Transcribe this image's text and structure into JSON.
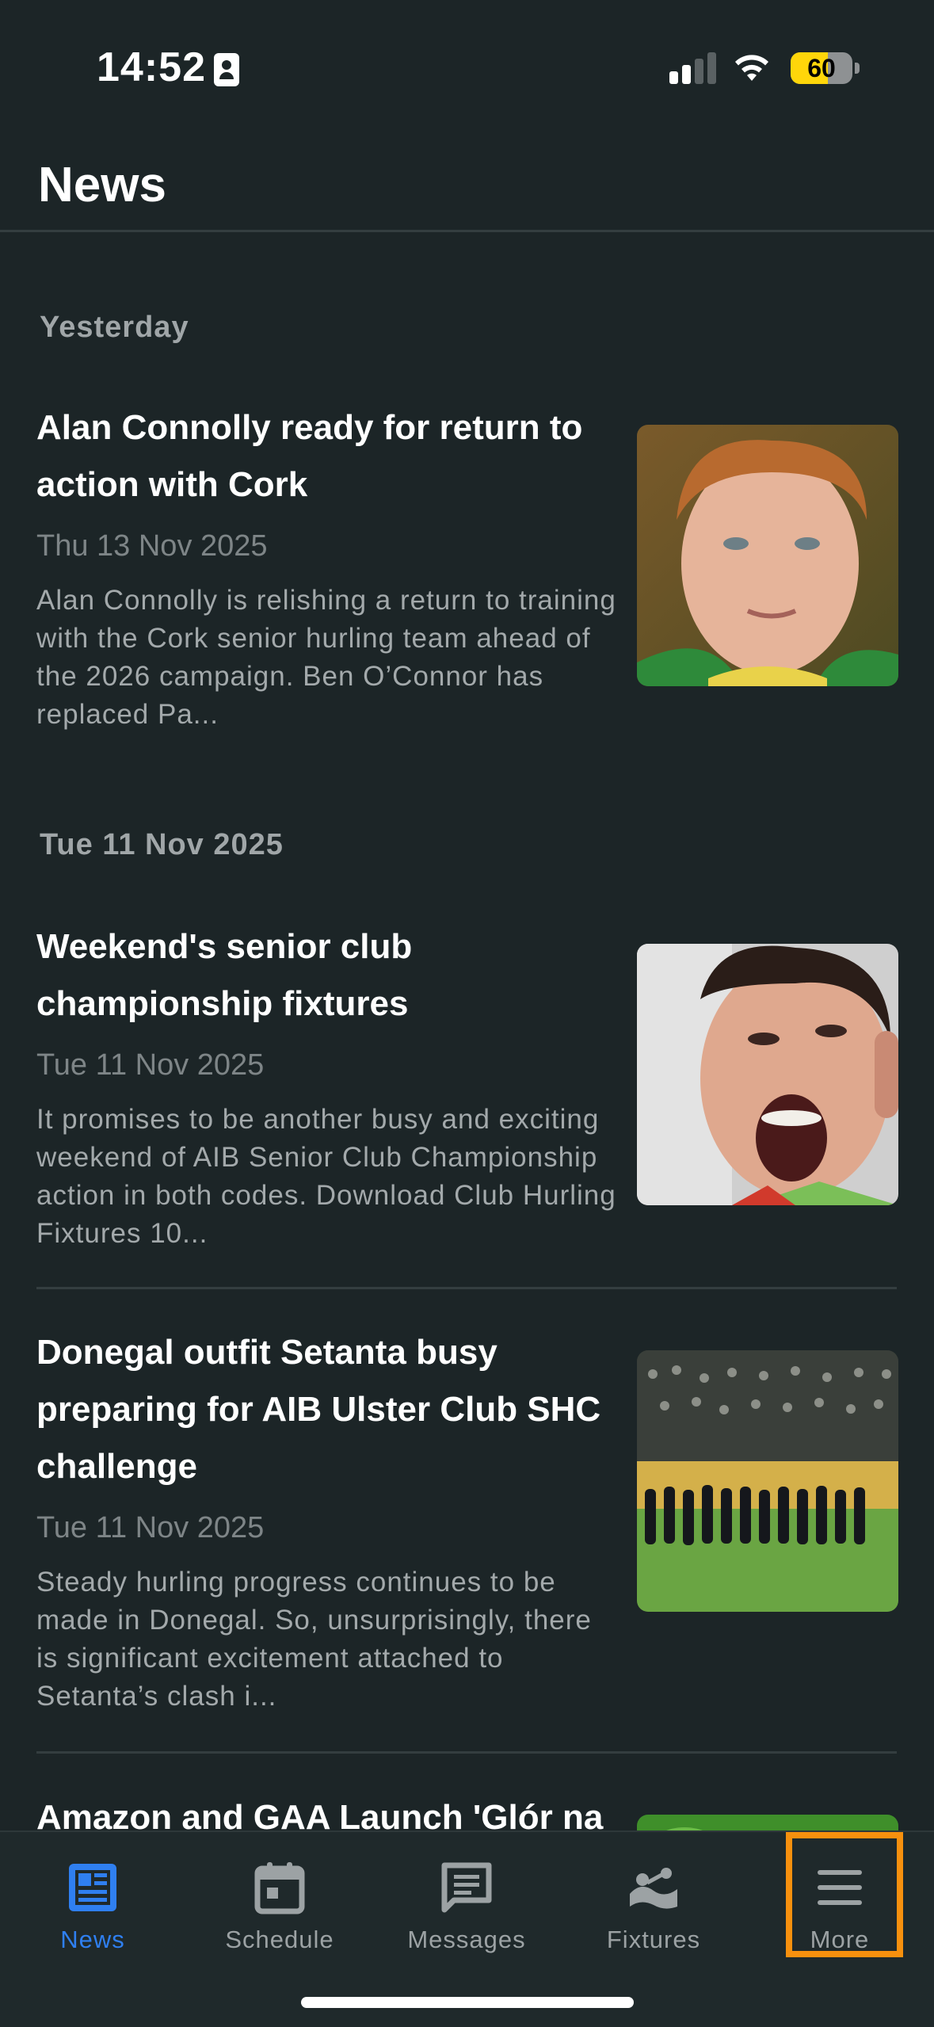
{
  "status_bar": {
    "time": "14:52",
    "battery_percent": "60",
    "battery_level": 0.6,
    "signal_bars": 2,
    "icons": [
      "contact-card-icon",
      "cellular-signal-icon",
      "wifi-icon",
      "battery-icon"
    ]
  },
  "header": {
    "title": "News"
  },
  "sections": [
    {
      "label": "Yesterday"
    },
    {
      "label": "Tue 11 Nov 2025"
    }
  ],
  "articles": [
    {
      "title": "Alan Connolly ready for return to action with Cork",
      "date": "Thu 13 Nov 2025",
      "excerpt": "Alan Connolly is relishing a return to training with the Cork senior hurling team ahead of the 2026 campaign. Ben O’Connor has replaced Pa...",
      "image": "player-portrait"
    },
    {
      "title": "Weekend's senior club championship fixtures",
      "date": "Tue 11 Nov 2025",
      "excerpt": "It promises to be another busy and exciting weekend of AIB Senior Club Championship action in both codes. Download Club Hurling Fixtures 10...",
      "image": "player-shouting"
    },
    {
      "title": "Donegal outfit Setanta busy preparing for AIB Ulster Club SHC challenge",
      "date": "Tue 11 Nov 2025",
      "excerpt": "Steady hurling progress continues to be made in Donegal. So, unsurprisingly, there is significant excitement attached to Setanta’s clash i...",
      "image": "team-lineup-crowd"
    },
    {
      "title": "Amazon and GAA Launch 'Glór na",
      "image": "green-banner"
    }
  ],
  "tab_bar": {
    "tabs": [
      {
        "label": "News",
        "icon": "newspaper-icon",
        "active": true
      },
      {
        "label": "Schedule",
        "icon": "calendar-icon",
        "active": false
      },
      {
        "label": "Messages",
        "icon": "message-icon",
        "active": false
      },
      {
        "label": "Fixtures",
        "icon": "fixtures-icon",
        "active": false
      },
      {
        "label": "More",
        "icon": "menu-icon",
        "active": false
      }
    ]
  },
  "colors": {
    "background": "#1c2527",
    "accent": "#2f7ff0",
    "highlight": "#f7900e"
  }
}
